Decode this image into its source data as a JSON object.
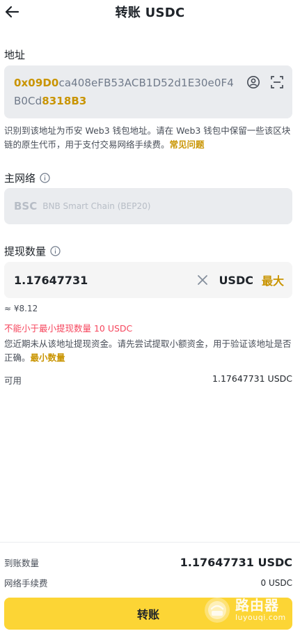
{
  "header": {
    "title": "转账 USDC"
  },
  "address": {
    "label": "地址",
    "prefix": "0x09D0",
    "middle": "ca408eFB53ACB1D52d1E30e0F4B0Cd",
    "suffix": "8318B3",
    "note": "识别到该地址为币安 Web3 钱包地址。请在 Web3 钱包中保留一些该区块链的原生代币，用于支付交易网络手续费。",
    "note_link": "常见问题"
  },
  "network": {
    "label": "主网络",
    "code": "BSC",
    "name": "BNB Smart Chain (BEP20)"
  },
  "amount": {
    "label": "提现数量",
    "value": "1.17647731",
    "unit": "USDC",
    "max_label": "最大",
    "fiat": "≈ ¥8.12",
    "error": "不能小于最小提现数量 10 USDC",
    "warning": "您近期未从该地址提现资金。请先尝试提取小额资金，用于验证该地址是否正确。",
    "warning_link": "最小数量"
  },
  "available": {
    "label": "可用",
    "value": "1.17647731 USDC"
  },
  "summary": {
    "receive_label": "到账数量",
    "receive_value": "1.17647731 USDC",
    "fee_label": "网络手续费",
    "fee_value": "0 USDC"
  },
  "submit": {
    "label": "转账"
  },
  "watermark": {
    "cn": "路由器",
    "en": "luyouqi.com"
  },
  "colors": {
    "accent": "#c99400",
    "button": "#fcd535",
    "error": "#f6465d",
    "field": "#eaecef"
  }
}
